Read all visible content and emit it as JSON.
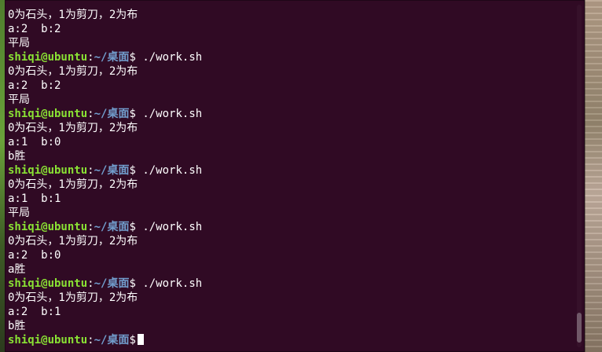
{
  "terminal": {
    "lines": [
      {
        "type": "output",
        "text": "0为石头，1为剪刀，2为布"
      },
      {
        "type": "output",
        "text": "a:2  b:2"
      },
      {
        "type": "output",
        "text": "平局"
      },
      {
        "type": "prompt",
        "user": "shiqi@ubuntu",
        "sep": ":",
        "path": "~/桌面",
        "dollar": "$",
        "command": " ./work.sh"
      },
      {
        "type": "output",
        "text": "0为石头，1为剪刀，2为布"
      },
      {
        "type": "output",
        "text": "a:2  b:2"
      },
      {
        "type": "output",
        "text": "平局"
      },
      {
        "type": "prompt",
        "user": "shiqi@ubuntu",
        "sep": ":",
        "path": "~/桌面",
        "dollar": "$",
        "command": " ./work.sh"
      },
      {
        "type": "output",
        "text": "0为石头，1为剪刀，2为布"
      },
      {
        "type": "output",
        "text": "a:1  b:0"
      },
      {
        "type": "output",
        "text": "b胜"
      },
      {
        "type": "prompt",
        "user": "shiqi@ubuntu",
        "sep": ":",
        "path": "~/桌面",
        "dollar": "$",
        "command": " ./work.sh"
      },
      {
        "type": "output",
        "text": "0为石头，1为剪刀，2为布"
      },
      {
        "type": "output",
        "text": "a:1  b:1"
      },
      {
        "type": "output",
        "text": "平局"
      },
      {
        "type": "prompt",
        "user": "shiqi@ubuntu",
        "sep": ":",
        "path": "~/桌面",
        "dollar": "$",
        "command": " ./work.sh"
      },
      {
        "type": "output",
        "text": "0为石头，1为剪刀，2为布"
      },
      {
        "type": "output",
        "text": "a:2  b:0"
      },
      {
        "type": "output",
        "text": "a胜"
      },
      {
        "type": "prompt",
        "user": "shiqi@ubuntu",
        "sep": ":",
        "path": "~/桌面",
        "dollar": "$",
        "command": " ./work.sh"
      },
      {
        "type": "output",
        "text": "0为石头，1为剪刀，2为布"
      },
      {
        "type": "output",
        "text": "a:2  b:1"
      },
      {
        "type": "output",
        "text": "b胜"
      },
      {
        "type": "prompt",
        "user": "shiqi@ubuntu",
        "sep": ":",
        "path": "~/桌面",
        "dollar": "$",
        "command": ""
      }
    ]
  },
  "colors": {
    "terminal_bg": "#300a24",
    "prompt_user": "#8ae234",
    "prompt_path": "#729fcf",
    "text": "#ffffff"
  }
}
